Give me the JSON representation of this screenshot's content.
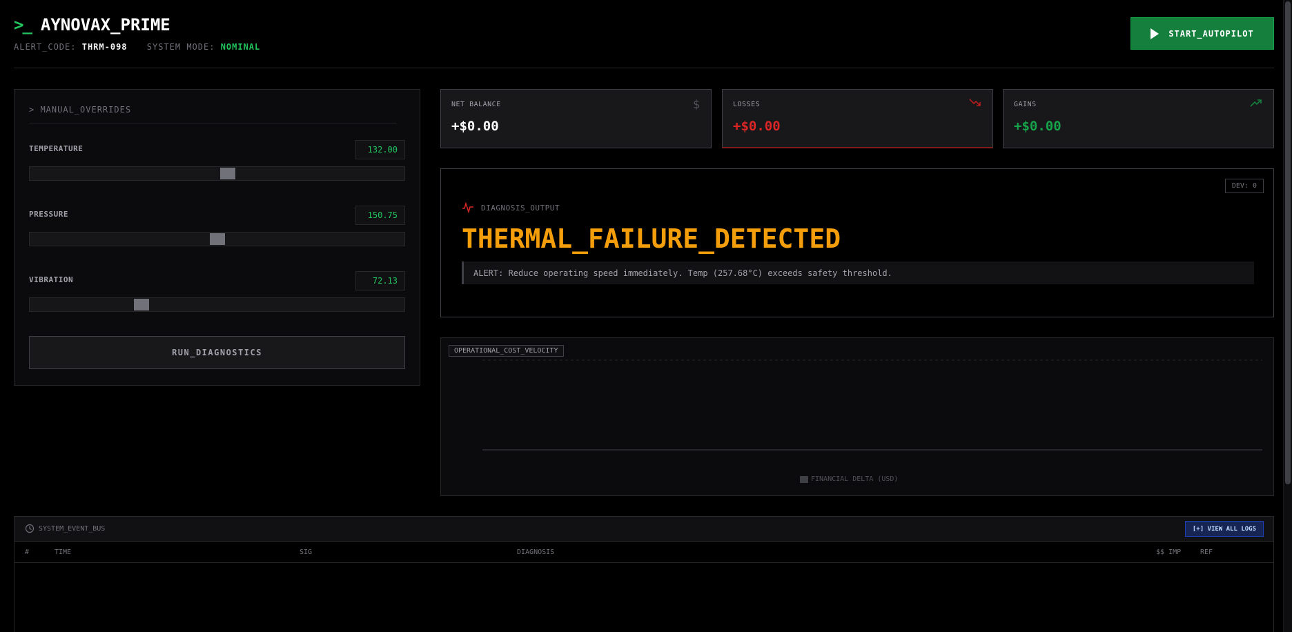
{
  "header": {
    "prompt_glyph": ">_",
    "title": "AYNOVAX_PRIME",
    "alert_code_label": "ALERT_CODE:",
    "alert_code": "THRM-098",
    "system_mode_label": "SYSTEM MODE:",
    "system_mode": "NOMINAL",
    "autopilot_label": "START_AUTOPILOT"
  },
  "overrides": {
    "title": "> MANUAL_OVERRIDES",
    "controls": [
      {
        "label": "TEMPERATURE",
        "value": "132.00",
        "level": 0.53
      },
      {
        "label": "PRESSURE",
        "value": "150.75",
        "level": 0.5
      },
      {
        "label": "VIBRATION",
        "value": "72.13",
        "level": 0.29
      }
    ],
    "run_label": "RUN_DIAGNOSTICS"
  },
  "stats": {
    "net_balance": {
      "label": "NET BALANCE",
      "value": "+$0.00",
      "icon": "$"
    },
    "losses": {
      "label": "LOSSES",
      "value": "+$0.00"
    },
    "gains": {
      "label": "GAINS",
      "value": "+$0.00"
    }
  },
  "diagnosis": {
    "dev_badge": "DEV: 0",
    "label": "DIAGNOSIS_OUTPUT",
    "title": "THERMAL_FAILURE_DETECTED",
    "alert": "ALERT: Reduce operating speed immediately. Temp (257.68°C) exceeds safety threshold."
  },
  "chart": {
    "tag": "OPERATIONAL_COST_VELOCITY",
    "legend": "FINANCIAL DELTA (USD)"
  },
  "chart_data": {
    "type": "bar",
    "title": "OPERATIONAL_COST_VELOCITY",
    "categories": [],
    "series": [
      {
        "name": "FINANCIAL DELTA (USD)",
        "values": []
      }
    ],
    "grid": true,
    "legend_position": "bottom"
  },
  "event_bus": {
    "title": "SYSTEM_EVENT_BUS",
    "view_all_label": "[+] VIEW ALL LOGS",
    "columns": [
      "#",
      "TIME",
      "SIG",
      "DIAGNOSIS",
      "$$ IMP",
      "REF"
    ],
    "rows": []
  },
  "colors": {
    "accent_green": "#22c55e",
    "alert_orange": "#f59e0b",
    "loss_red": "#dc2626",
    "gain_green": "#16a34a"
  }
}
